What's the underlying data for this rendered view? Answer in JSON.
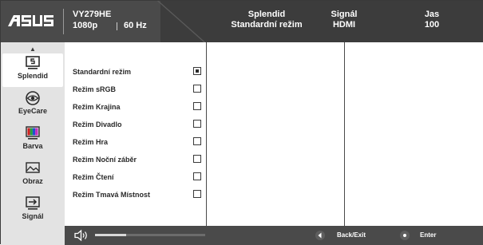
{
  "header": {
    "logo": "ASUS",
    "model": "VY279HE",
    "resolution": "1080p",
    "refresh_rate": "60 Hz",
    "columns": [
      {
        "title": "Splendid",
        "value": "Standardní režim"
      },
      {
        "title": "Signál",
        "value": "HDMI"
      },
      {
        "title": "Jas",
        "value": "100"
      }
    ]
  },
  "sidebar": {
    "up_arrow": "▲",
    "down_arrow": "▼",
    "items": [
      {
        "label": "Splendid",
        "icon": "splendid-icon",
        "active": true
      },
      {
        "label": "EyeCare",
        "icon": "eye-icon",
        "active": false
      },
      {
        "label": "Barva",
        "icon": "color-bars-icon",
        "active": false
      },
      {
        "label": "Obraz",
        "icon": "image-icon",
        "active": false
      },
      {
        "label": "Signál",
        "icon": "input-icon",
        "active": false
      }
    ]
  },
  "options": {
    "items": [
      {
        "label": "Standardní režim",
        "checked": true
      },
      {
        "label": "Režim sRGB",
        "checked": false
      },
      {
        "label": "Režim Krajina",
        "checked": false
      },
      {
        "label": "Režim Divadlo",
        "checked": false
      },
      {
        "label": "Režim Hra",
        "checked": false
      },
      {
        "label": "Režim Noční záběr",
        "checked": false
      },
      {
        "label": "Režim Čtení",
        "checked": false
      },
      {
        "label": "Režim Tmavá Místnost",
        "checked": false
      }
    ]
  },
  "footer": {
    "volume_icon": "speaker-icon",
    "volume_level": 0.28,
    "back_label": "Back/Exit",
    "enter_label": "Enter"
  },
  "colors": {
    "header_bg": "#4a4a4a",
    "sidebar_bg": "#e3e3e3",
    "active_bg": "#ffffff",
    "text_dark": "#2a2a2a"
  }
}
